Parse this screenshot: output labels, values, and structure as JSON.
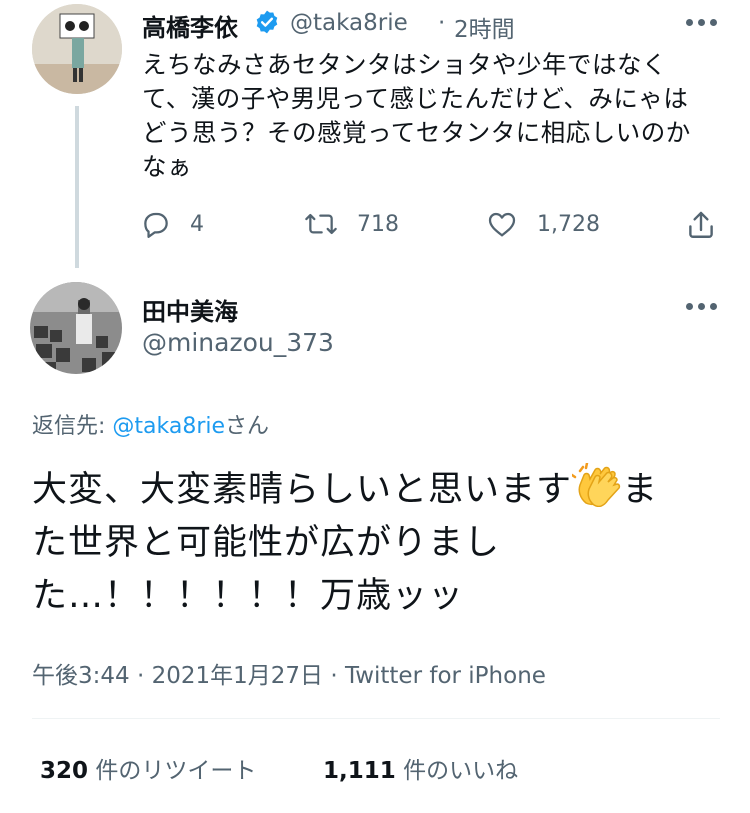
{
  "original_tweet": {
    "display_name": "高橋李依",
    "handle": "@taka8rie",
    "separator": "·",
    "time": "2時間",
    "text_lines": [
      "えちなみさあセタンタはショタや少年ではなく",
      "て、漢の子や男児って感じたんだけど、みにゃは",
      "どう思う？その感覚ってセタンタに相応しいのか",
      "なぁ"
    ],
    "reply_count": "4",
    "retweet_count": "718",
    "like_count": "1,728"
  },
  "reply_tweet": {
    "display_name": "田中美海",
    "handle": "@minazou_373",
    "reply_to_prefix": "返信先: ",
    "reply_to_handle": "@taka8rie",
    "reply_to_suffix": "さん",
    "text_line1_before_emoji": "大変、大変素晴らしいと思います",
    "text_line1_after_emoji": "ま",
    "text_line2": "た世界と可能性が広がりまし",
    "text_line3": "た…！！！！！！万歳ッッ",
    "timestamp": "午後3:44 · 2021年1月27日 · ",
    "source": "Twitter for iPhone",
    "retweet_stat_count": "320",
    "retweet_stat_label": " 件のリツイート",
    "like_stat_count": "1,111",
    "like_stat_label": " 件のいいね"
  },
  "colors": {
    "link": "#1d9bf0",
    "muted": "#536471",
    "verified": "#1d9bf0"
  },
  "icons": [
    "reply-icon",
    "retweet-icon",
    "like-icon",
    "share-icon",
    "verified-icon",
    "more-icon",
    "clapping-hands-icon"
  ]
}
